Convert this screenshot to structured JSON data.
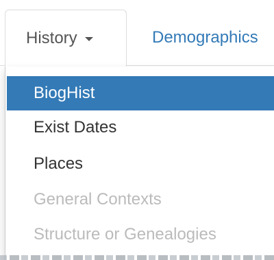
{
  "tabs": {
    "history_label": "History",
    "demographics_label": "Demographics"
  },
  "dropdown": {
    "items": [
      {
        "label": "BiogHist",
        "state": "active"
      },
      {
        "label": "Exist Dates",
        "state": "enabled"
      },
      {
        "label": "Places",
        "state": "enabled"
      },
      {
        "label": "General Contexts",
        "state": "disabled"
      },
      {
        "label": "Structure or Genealogies",
        "state": "disabled"
      }
    ]
  },
  "colors": {
    "accent": "#337ab7",
    "text": "#333333",
    "disabled": "#bbbbbb",
    "tab_text": "#555555"
  },
  "icons": {
    "tab_caret": "caret-down-icon"
  }
}
